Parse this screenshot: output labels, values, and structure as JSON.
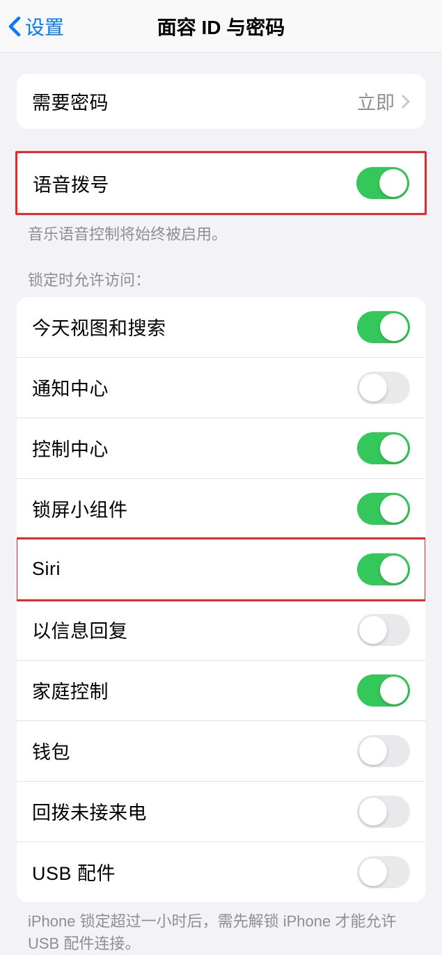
{
  "nav": {
    "back_label": "设置",
    "title": "面容 ID 与密码"
  },
  "require_passcode": {
    "label": "需要密码",
    "value": "立即"
  },
  "voice_dial": {
    "label": "语音拨号",
    "footer": "音乐语音控制将始终被启用。",
    "enabled": true
  },
  "lockscreen_header": "锁定时允许访问：",
  "lockscreen_items": [
    {
      "label": "今天视图和搜索",
      "enabled": true,
      "highlight": false
    },
    {
      "label": "通知中心",
      "enabled": false,
      "highlight": false
    },
    {
      "label": "控制中心",
      "enabled": true,
      "highlight": false
    },
    {
      "label": "锁屏小组件",
      "enabled": true,
      "highlight": false
    },
    {
      "label": "Siri",
      "enabled": true,
      "highlight": true
    },
    {
      "label": "以信息回复",
      "enabled": false,
      "highlight": false
    },
    {
      "label": "家庭控制",
      "enabled": true,
      "highlight": false
    },
    {
      "label": "钱包",
      "enabled": false,
      "highlight": false
    },
    {
      "label": "回拨未接来电",
      "enabled": false,
      "highlight": false
    },
    {
      "label": "USB 配件",
      "enabled": false,
      "highlight": false
    }
  ],
  "lockscreen_footer": "iPhone 锁定超过一小时后，需先解锁 iPhone 才能允许 USB 配件连接。"
}
